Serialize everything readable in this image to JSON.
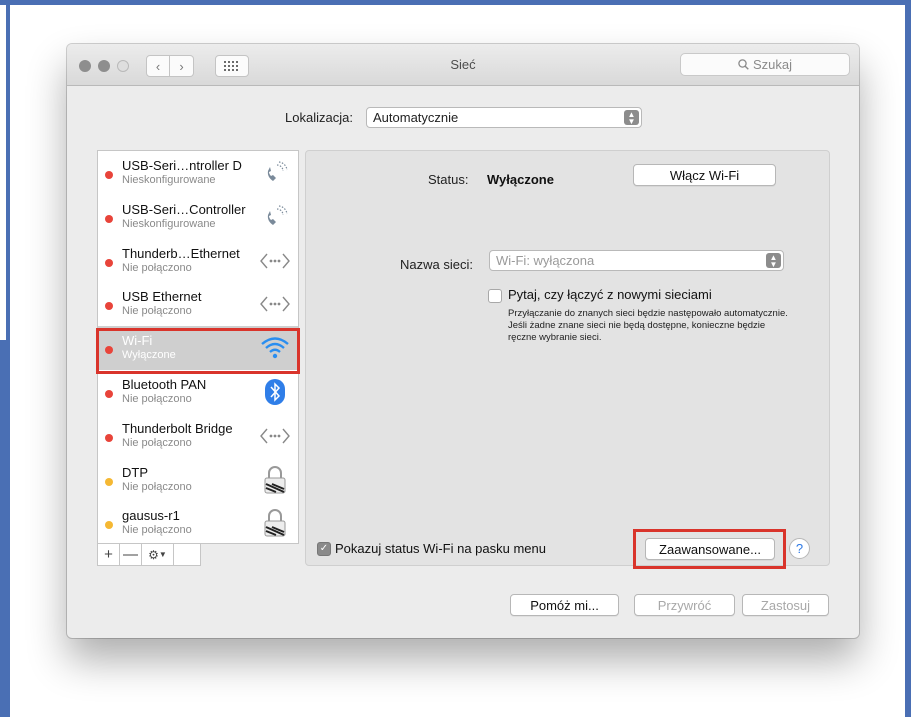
{
  "window": {
    "title": "Sieć"
  },
  "toolbar": {
    "search_placeholder": "Szukaj"
  },
  "location": {
    "label": "Lokalizacja:",
    "value": "Automatycznie"
  },
  "services": [
    {
      "name": "USB-Seri…ntroller D",
      "status": "Nieskonfigurowane",
      "dot": "red",
      "icon": "phone-icon"
    },
    {
      "name": "USB-Seri…Controller",
      "status": "Nieskonfigurowane",
      "dot": "red",
      "icon": "phone-icon"
    },
    {
      "name": "Thunderb…Ethernet",
      "status": "Nie połączono",
      "dot": "red",
      "icon": "ethernet-arrows-icon"
    },
    {
      "name": "USB Ethernet",
      "status": "Nie połączono",
      "dot": "red",
      "icon": "ethernet-arrows-icon"
    },
    {
      "name": "Wi-Fi",
      "status": "Wyłączone",
      "dot": "red",
      "icon": "wifi-icon",
      "selected": true
    },
    {
      "name": "Bluetooth PAN",
      "status": "Nie połączono",
      "dot": "red",
      "icon": "bluetooth-icon"
    },
    {
      "name": "Thunderbolt Bridge",
      "status": "Nie połączono",
      "dot": "red",
      "icon": "ethernet-arrows-icon"
    },
    {
      "name": "DTP",
      "status": "Nie połączono",
      "dot": "yellow",
      "icon": "lock-icon"
    },
    {
      "name": "gausus-r1",
      "status": "Nie połączono",
      "dot": "yellow",
      "icon": "lock-icon"
    }
  ],
  "sidebar_controls": {
    "add": "+",
    "remove": "—"
  },
  "detail": {
    "status_label": "Status:",
    "status_value": "Wyłączone",
    "wifi_button": "Włącz Wi-Fi",
    "network_label": "Nazwa sieci:",
    "network_value": "Wi-Fi: wyłączona",
    "ask_label": "Pytaj, czy łączyć z nowymi sieciami",
    "ask_description": "Przyłączanie do znanych sieci będzie następowało automatycznie. Jeśli żadne znane sieci nie będą dostępne, konieczne będzie ręczne wybranie sieci.",
    "show_status_label": "Pokazuj status Wi-Fi na pasku menu",
    "advanced_button": "Zaawansowane...",
    "help_button": "?"
  },
  "footer": {
    "assist": "Pomóż mi...",
    "revert": "Przywróć",
    "apply": "Zastosuj"
  },
  "colors": {
    "frame": "#4a6fb4",
    "highlight": "#d9342b",
    "status_red": "#e8443a",
    "status_yellow": "#f5b833",
    "selection": "#cfcfcf"
  }
}
